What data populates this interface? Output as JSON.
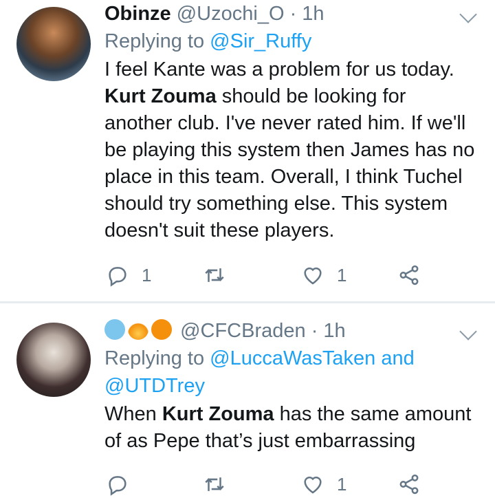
{
  "tweets": [
    {
      "name": "Obinze",
      "handle": "@Uzochi_O",
      "time": "· 1h",
      "replying_prefix": "Replying to ",
      "replying_to": "@Sir_Ruffy",
      "body_pre": "I feel Kante was a problem for us today. ",
      "body_bold": "Kurt Zouma",
      "body_post": " should be looking for another club. I've never rated him. If we'll be playing this system then James has no place in this team. Overall, I think Tuchel should try something else. This system doesn't suit these players.",
      "reply_count": "1",
      "retweet_count": "",
      "like_count": "1"
    },
    {
      "name": "",
      "handle": "@CFCBraden",
      "time": "· 1h",
      "replying_prefix": "Replying to ",
      "replying_to": "@LuccaWasTaken and @UTDTrey",
      "body_pre": "When ",
      "body_bold": "Kurt Zouma",
      "body_post": " has the same amount of as Pepe that’s just embarrassing",
      "reply_count": "",
      "retweet_count": "",
      "like_count": "1"
    }
  ],
  "colors": {
    "text": "#14171a",
    "secondary": "#657786",
    "link": "#1da1f2",
    "divider": "#e6ecf0"
  },
  "icons": [
    "reply-icon",
    "retweet-icon",
    "like-icon",
    "share-icon",
    "chevron-down-icon",
    "cold-face-emoji",
    "fire-emoji",
    "orange-circle-emoji"
  ]
}
